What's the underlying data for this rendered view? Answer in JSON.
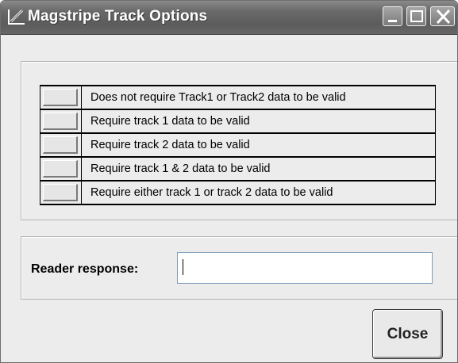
{
  "window": {
    "title": "Magstripe Track Options",
    "title_icon": "pen-chart-icon"
  },
  "options": [
    {
      "label": "Does not require Track1 or Track2 data to be valid"
    },
    {
      "label": "Require track 1  data to be valid"
    },
    {
      "label": "Require track 2 data to be valid"
    },
    {
      "label": "Require track 1 & 2 data to be valid"
    },
    {
      "label": "Require either track 1 or track 2 data to be valid"
    }
  ],
  "response": {
    "label": "Reader response:",
    "value": ""
  },
  "buttons": {
    "close_label": "Close"
  }
}
